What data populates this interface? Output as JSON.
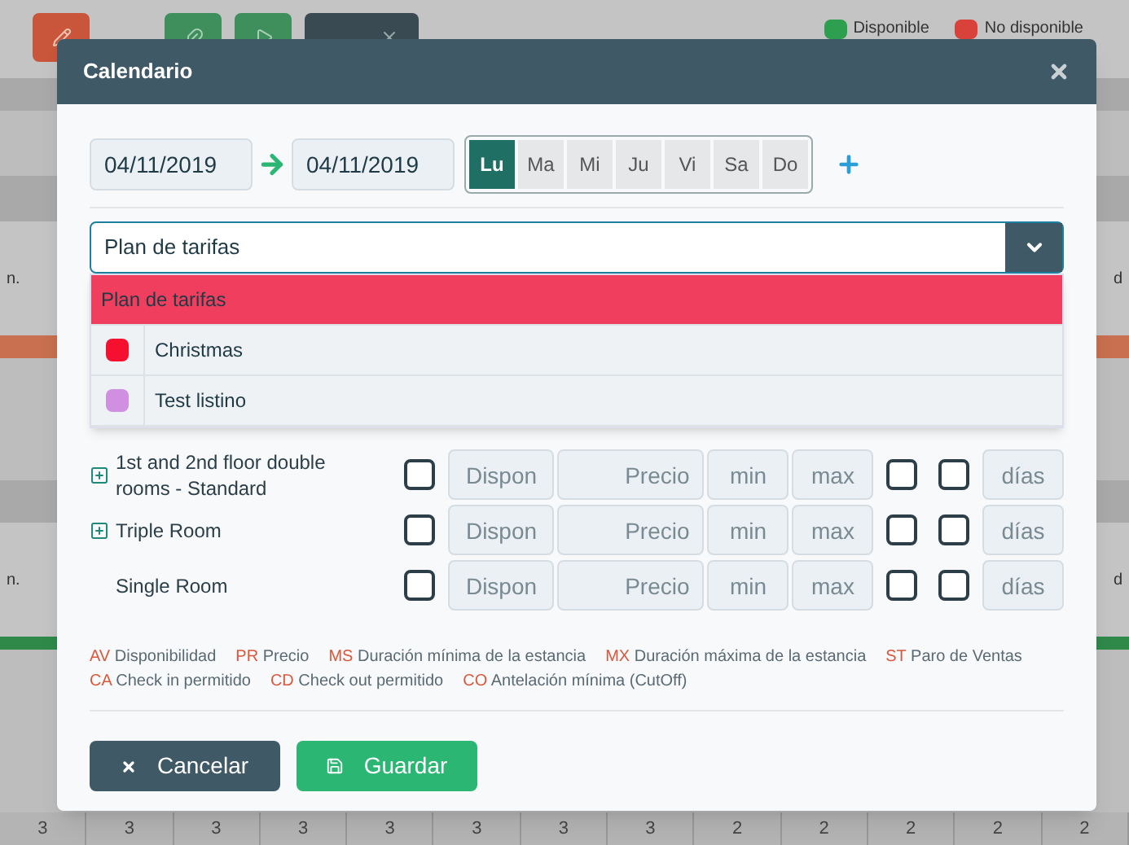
{
  "background": {
    "legend": [
      {
        "label": "Disponible",
        "color": "#2e9e4f"
      },
      {
        "label": "No disponible",
        "color": "#d9413b"
      }
    ],
    "left_edge": [
      "n.",
      "n."
    ],
    "right_edge": [
      "d",
      "d"
    ],
    "bottom_row": [
      "3",
      "3",
      "3",
      "3",
      "3",
      "3",
      "3",
      "3",
      "2",
      "2",
      "2",
      "2",
      "2"
    ]
  },
  "modal": {
    "title": "Calendario",
    "date_from": "04/11/2019",
    "date_to": "04/11/2019",
    "weekdays": [
      {
        "label": "Lu",
        "selected": true
      },
      {
        "label": "Ma",
        "selected": false
      },
      {
        "label": "Mi",
        "selected": false
      },
      {
        "label": "Ju",
        "selected": false
      },
      {
        "label": "Vi",
        "selected": false
      },
      {
        "label": "Sa",
        "selected": false
      },
      {
        "label": "Do",
        "selected": false
      }
    ],
    "select": {
      "value": "Plan de tarifas",
      "expanded": true,
      "options": [
        {
          "label": "Plan de tarifas",
          "selected": true
        },
        {
          "label": "Christmas",
          "color": "#f5102f",
          "selected": false
        },
        {
          "label": "Test listino",
          "color": "#d08fe0",
          "selected": false
        }
      ]
    },
    "rooms": [
      {
        "name": "1st and 2nd floor double rooms - Standard",
        "expandable": true,
        "checks": [
          false,
          false,
          false
        ],
        "placeholders": [
          "Dispon",
          "Precio",
          "min",
          "max",
          "días"
        ]
      },
      {
        "name": "Triple Room",
        "expandable": true,
        "checks": [
          false,
          false,
          false
        ],
        "placeholders": [
          "Dispon",
          "Precio",
          "min",
          "max",
          "días"
        ]
      },
      {
        "name": "Single Room",
        "expandable": false,
        "checks": [
          false,
          false,
          false
        ],
        "placeholders": [
          "Dispon",
          "Precio",
          "min",
          "max",
          "días"
        ]
      }
    ],
    "legend": [
      {
        "code": "AV",
        "label": "Disponibilidad"
      },
      {
        "code": "PR",
        "label": "Precio"
      },
      {
        "code": "MS",
        "label": "Duración mínima de la estancia"
      },
      {
        "code": "MX",
        "label": "Duración máxima de la estancia"
      },
      {
        "code": "ST",
        "label": "Paro de Ventas"
      },
      {
        "code": "CA",
        "label": "Check in permitido"
      },
      {
        "code": "CD",
        "label": "Check out permitido"
      },
      {
        "code": "CO",
        "label": "Antelación mínima (CutOff)"
      }
    ],
    "cancel": "Cancelar",
    "save": "Guardar"
  }
}
